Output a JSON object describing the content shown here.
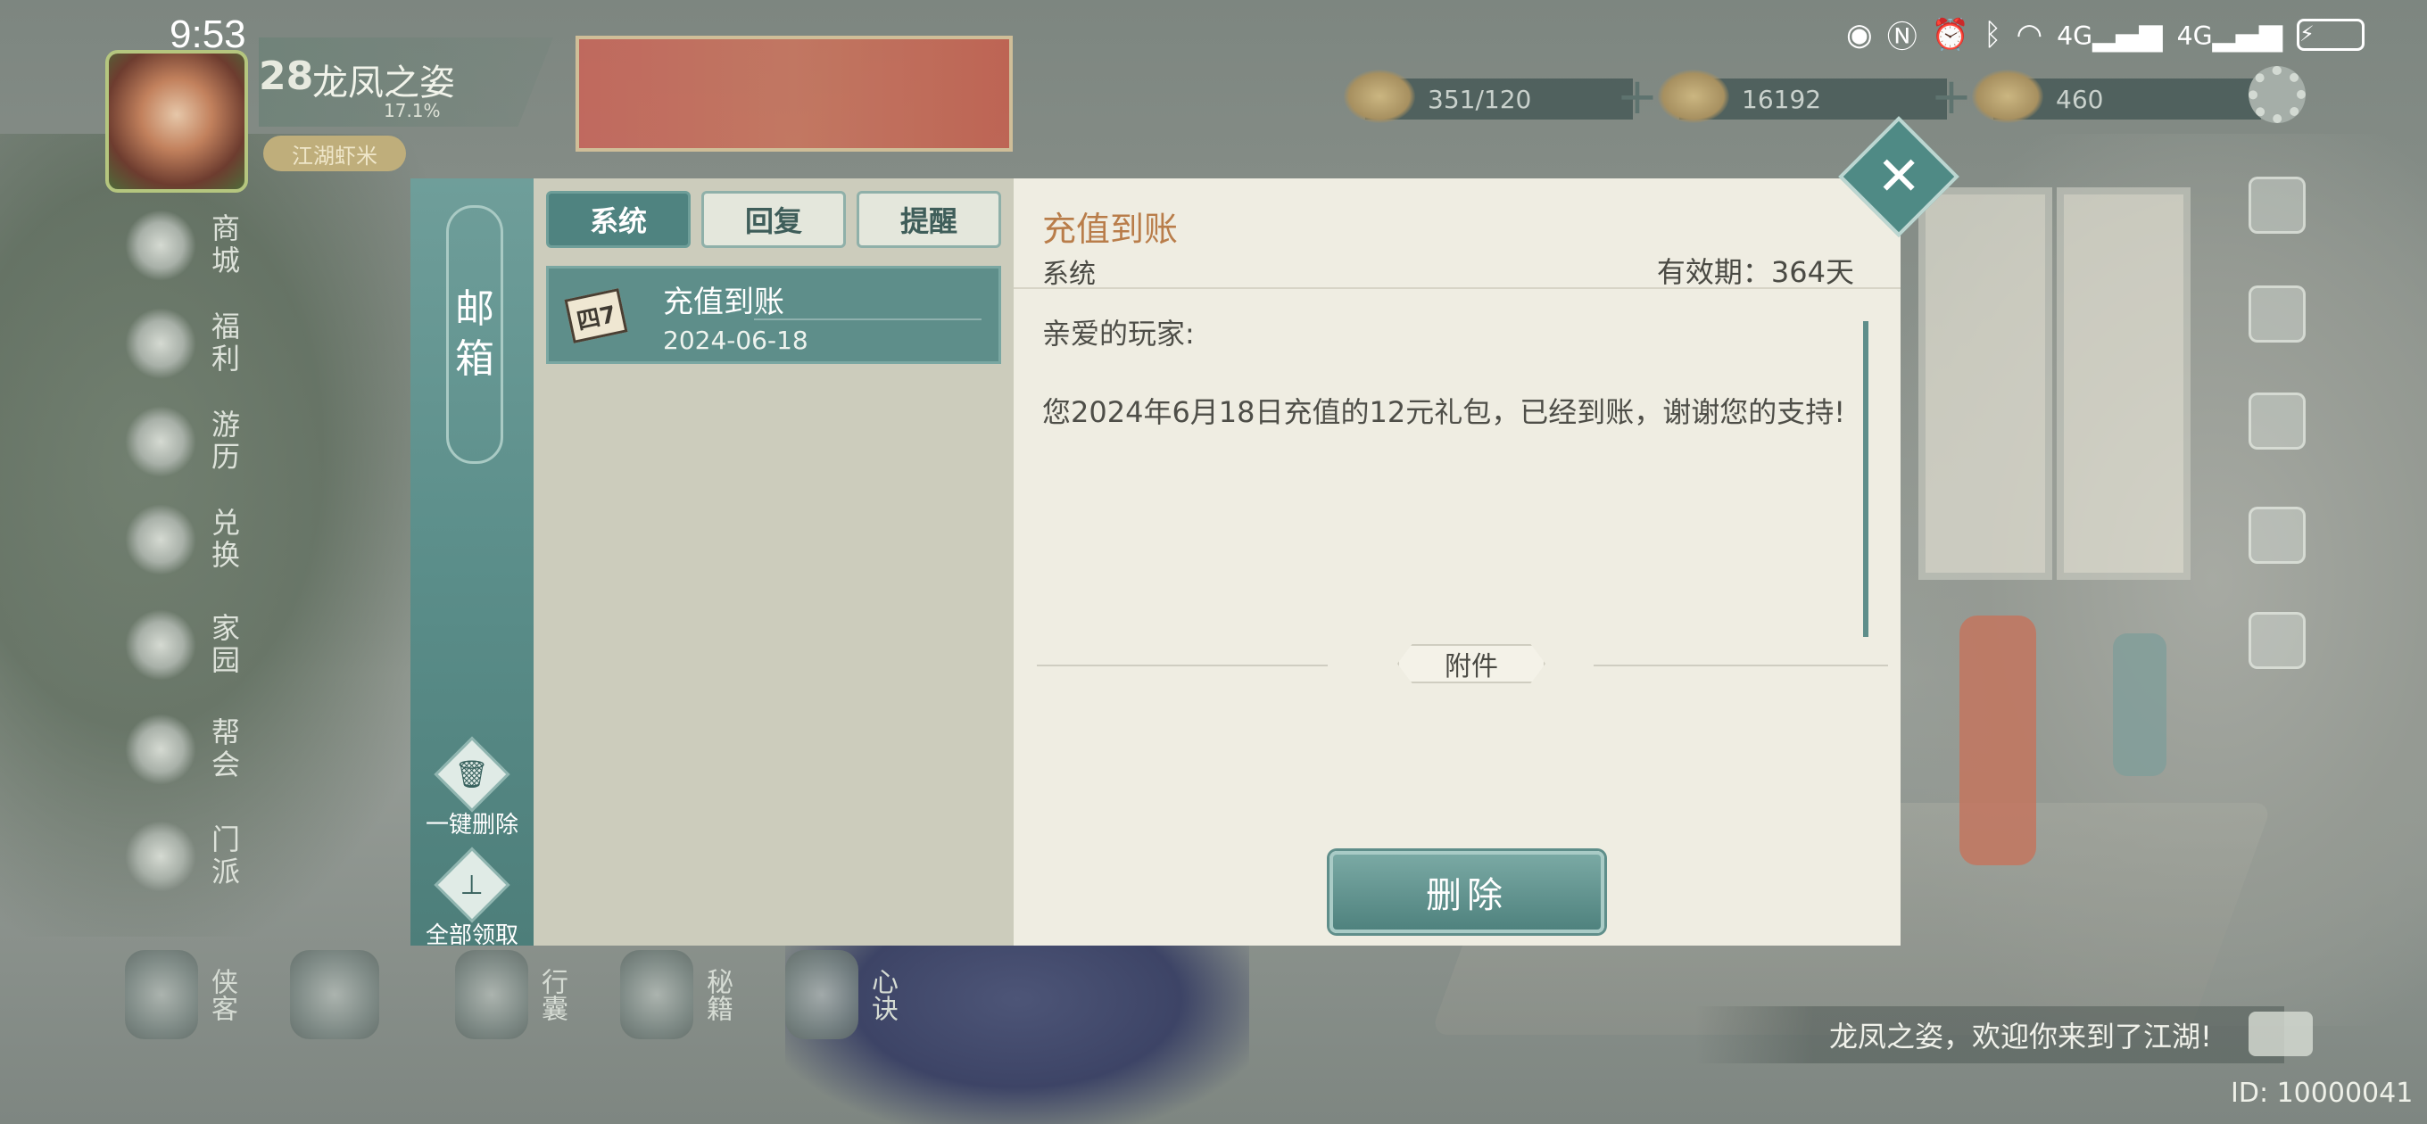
{
  "status_bar": {
    "time": "9:53",
    "icons": [
      "eye-icon",
      "nfc-icon",
      "alarm-icon",
      "bluetooth-icon",
      "wifi-icon",
      "signal-4g-icon",
      "signal-4g-icon",
      "battery-charging-icon"
    ],
    "net_labels": [
      "4G",
      "4G"
    ]
  },
  "player": {
    "level": "28",
    "name": "龙凤之姿",
    "exp_percent": "17.1%",
    "title": "江湖虾米"
  },
  "resources": [
    {
      "icon": "stamina-icon",
      "value": "351/120"
    },
    {
      "icon": "coin-icon",
      "value": "16192"
    },
    {
      "icon": "ingot-icon",
      "value": "460"
    }
  ],
  "left_menu": [
    {
      "icon": "shop-icon",
      "label": "商城"
    },
    {
      "icon": "welfare-icon",
      "label": "福利"
    },
    {
      "icon": "travel-icon",
      "label": "游历"
    },
    {
      "icon": "exchange-icon",
      "label": "兑换"
    },
    {
      "icon": "home-icon",
      "label": "家园"
    },
    {
      "icon": "guild-icon",
      "label": "帮会"
    },
    {
      "icon": "sect-icon",
      "label": "门派"
    }
  ],
  "bottom_menu": [
    {
      "icon": "hero-icon",
      "label": "侠客"
    },
    {
      "icon": "bag-icon",
      "label": "行囊"
    },
    {
      "icon": "manual-icon",
      "label": "秘籍"
    },
    {
      "icon": "mind-icon",
      "label": "心诀"
    }
  ],
  "mailbox": {
    "title_chars": [
      "邮",
      "箱"
    ],
    "tabs": [
      {
        "label": "系统",
        "active": true
      },
      {
        "label": "回复",
        "active": false
      },
      {
        "label": "提醒",
        "active": false
      }
    ],
    "side_actions": {
      "delete_all": "一键删除",
      "claim_all": "全部领取"
    },
    "mails": [
      {
        "subject": "充值到账",
        "date": "2024-06-18",
        "icon": "mail-letter-icon",
        "icon_text": "四7"
      }
    ],
    "detail": {
      "subject": "充值到账",
      "sender": "系统",
      "validity": "有效期：364天",
      "greeting": "亲爱的玩家:",
      "body": "您2024年6月18日充值的12元礼包，已经到账，谢谢您的支持!",
      "attachment_label": "附件",
      "delete_button": "删除"
    }
  },
  "chat": {
    "message": "龙凤之姿，欢迎你来到了江湖!"
  },
  "player_id": "ID: 10000041"
}
